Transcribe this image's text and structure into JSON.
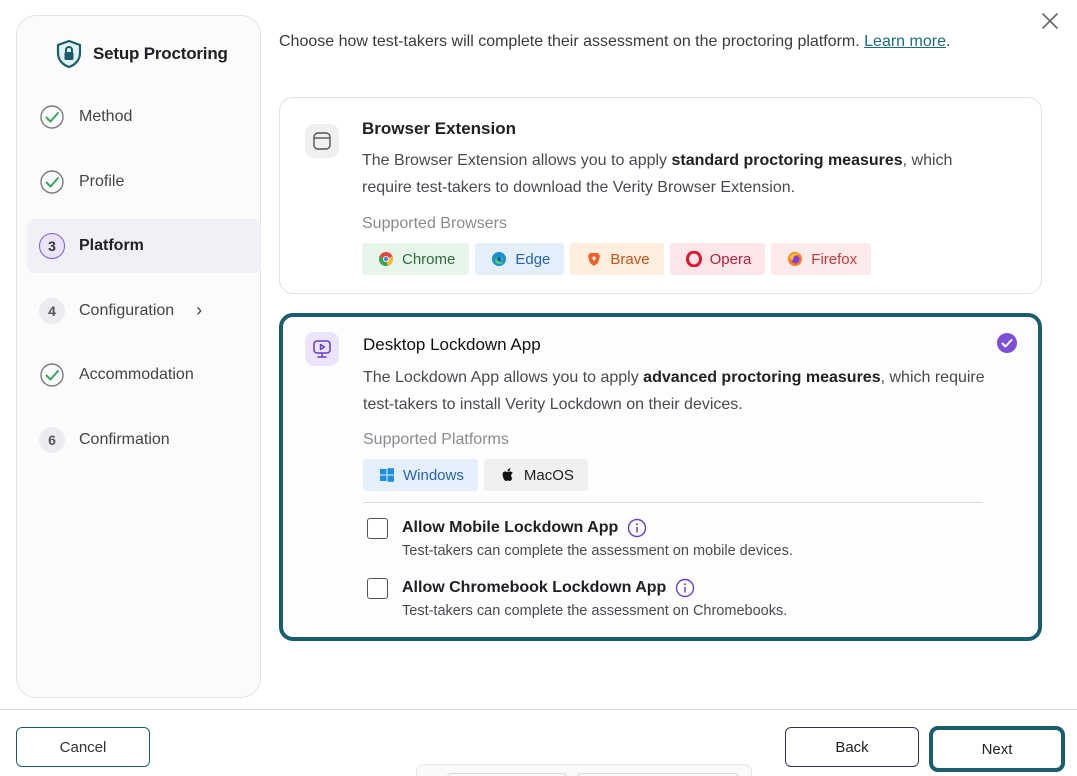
{
  "sidebar": {
    "title": "Setup Proctoring",
    "steps": [
      {
        "badge": "",
        "label": "Method",
        "state": "done"
      },
      {
        "badge": "",
        "label": "Profile",
        "state": "done"
      },
      {
        "badge": "3",
        "label": "Platform",
        "state": "active"
      },
      {
        "badge": "4",
        "label": "Configuration",
        "chevron": "›",
        "state": "pending"
      },
      {
        "badge": "",
        "label": "Accommodation",
        "state": "done"
      },
      {
        "badge": "6",
        "label": "Confirmation",
        "state": "pending"
      }
    ]
  },
  "main": {
    "intro_text": "Choose how test-takers will complete their assessment on the proctoring platform. ",
    "learn_more": "Learn more",
    "intro_end": ".",
    "browser_extension": {
      "title": "Browser Extension",
      "desc_before": "The Browser Extension allows you to apply ",
      "desc_bold": "standard proctoring measures",
      "desc_after": ", which require test-takers to download the Verity Browser Extension.",
      "supported_label": "Supported Browsers",
      "browsers": [
        {
          "name": "Chrome",
          "icon": "chrome-icon",
          "bg": "#e7f4ea",
          "color": "#2f6b3e"
        },
        {
          "name": "Edge",
          "icon": "edge-icon",
          "bg": "#e3f0fb",
          "color": "#2a63a8"
        },
        {
          "name": "Brave",
          "icon": "brave-icon",
          "bg": "#fdeede",
          "color": "#c0541c"
        },
        {
          "name": "Opera",
          "icon": "opera-icon",
          "bg": "#fce6ea",
          "color": "#b0233a"
        },
        {
          "name": "Firefox",
          "icon": "firefox-icon",
          "bg": "#fdebeb",
          "color": "#c23a3a"
        }
      ]
    },
    "desktop_app": {
      "title": "Desktop Lockdown App",
      "desc_before": "The Lockdown App allows you to apply ",
      "desc_bold": "advanced proctoring measures",
      "desc_after": ", which require test-takers to install Verity Lockdown on their devices.",
      "supported_label": "Supported Platforms",
      "platforms": [
        {
          "name": "Windows",
          "icon": "windows-icon",
          "bg": "#e3f0fb",
          "color": "#2a63a8"
        },
        {
          "name": "MacOS",
          "icon": "apple-icon",
          "bg": "#f0f0f2",
          "color": "#222222"
        }
      ],
      "options": [
        {
          "title": "Allow Mobile Lockdown App",
          "desc": "Test-takers can complete the assessment on mobile devices.",
          "checked": false
        },
        {
          "title": "Allow Chromebook Lockdown App",
          "desc": "Test-takers can complete the assessment on Chromebooks.",
          "checked": false
        }
      ]
    }
  },
  "footer": {
    "cancel": "Cancel",
    "back": "Back",
    "next": "Next"
  },
  "colors": {
    "accent": "#1a5e6e",
    "purple": "#7c4fd6",
    "check_green": "#3aa55a"
  }
}
